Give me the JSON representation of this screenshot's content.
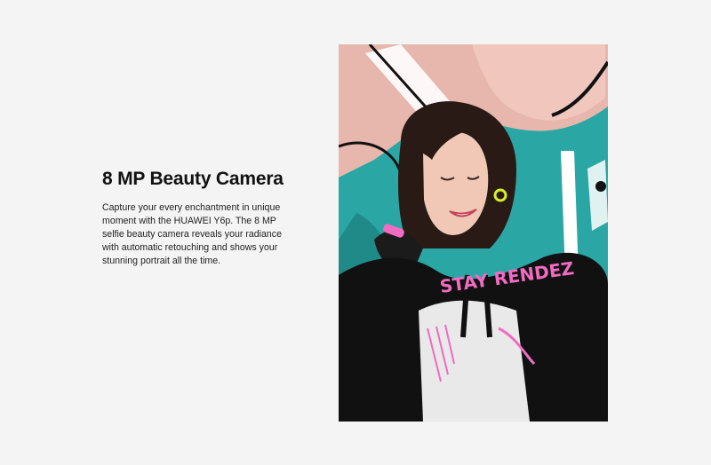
{
  "feature": {
    "title": "8 MP Beauty Camera",
    "description": "Capture your every enchantment in unique moment with the HUAWEI Y6p. The 8 MP selfie beauty camera reveals your radiance with automatic retouching and shows your stunning portrait all the time."
  },
  "photo": {
    "graffiti_text": "STAY RENDEZ",
    "colors": {
      "graffiti_teal": "#2aa6a4",
      "hoodie_black": "#111111",
      "hoodie_pink_print": "#f06bc1",
      "earring_yellow": "#d7ee2a"
    }
  }
}
